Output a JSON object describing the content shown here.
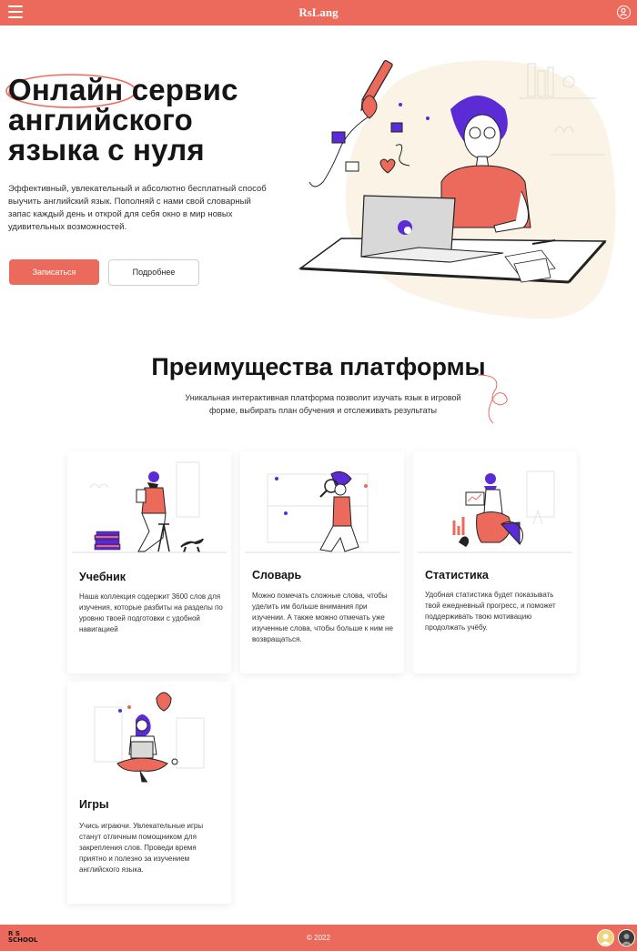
{
  "header": {
    "brand": "RsLang",
    "menu_icon": "hamburger-icon",
    "user_icon": "user-icon"
  },
  "hero": {
    "title_lines": [
      "Онлайн сервис",
      "английского",
      "языка с нуля"
    ],
    "description": "Эффективный, увлекательный и абсолютно бесплатный способ выучить английский язык. Пополняй с нами свой словарный запас каждый день и открой для себя окно в мир новых удивительных возможностей.",
    "primary_button": "Записаться",
    "secondary_button": "Подробнее"
  },
  "advantages": {
    "title": "Преимущества платформы",
    "subtitle": "Уникальная интерактивная платформа позволит изучать язык в игровой форме, выбирать план обучения и отслеживать результаты",
    "cards": [
      {
        "title": "Учебник",
        "text": "Наша коллекция содержит 3600 слов для изучения, которые разбиты на разделы по уровню твоей подготовки с удобной навигацией"
      },
      {
        "title": "Словарь",
        "text": "Можно помечать сложные слова, чтобы уделить им больше внимания при изучении. А также можно отмечать уже изученные слова, чтобы больше к ним не возвращаться."
      },
      {
        "title": "Статистика",
        "text": "Удобная статистика будет показывать твой ежедневный прогресс, и поможет поддерживать твою мотивацию продолжать учёбу."
      },
      {
        "title": "Игры",
        "text": "Учись играючи. Увлекательные игры станут отличным помощником для закрепления слов. Проведи время приятно и полезно за изучением английского языка."
      }
    ]
  },
  "footer": {
    "logo_line1": "R S",
    "logo_line2": "SCHOOL",
    "copyright": "© 2022",
    "avatars": [
      "author-avatar-1",
      "author-avatar-2"
    ]
  },
  "colors": {
    "accent": "#ec6a5c",
    "purple": "#5b2bd6",
    "text": "#151515"
  }
}
